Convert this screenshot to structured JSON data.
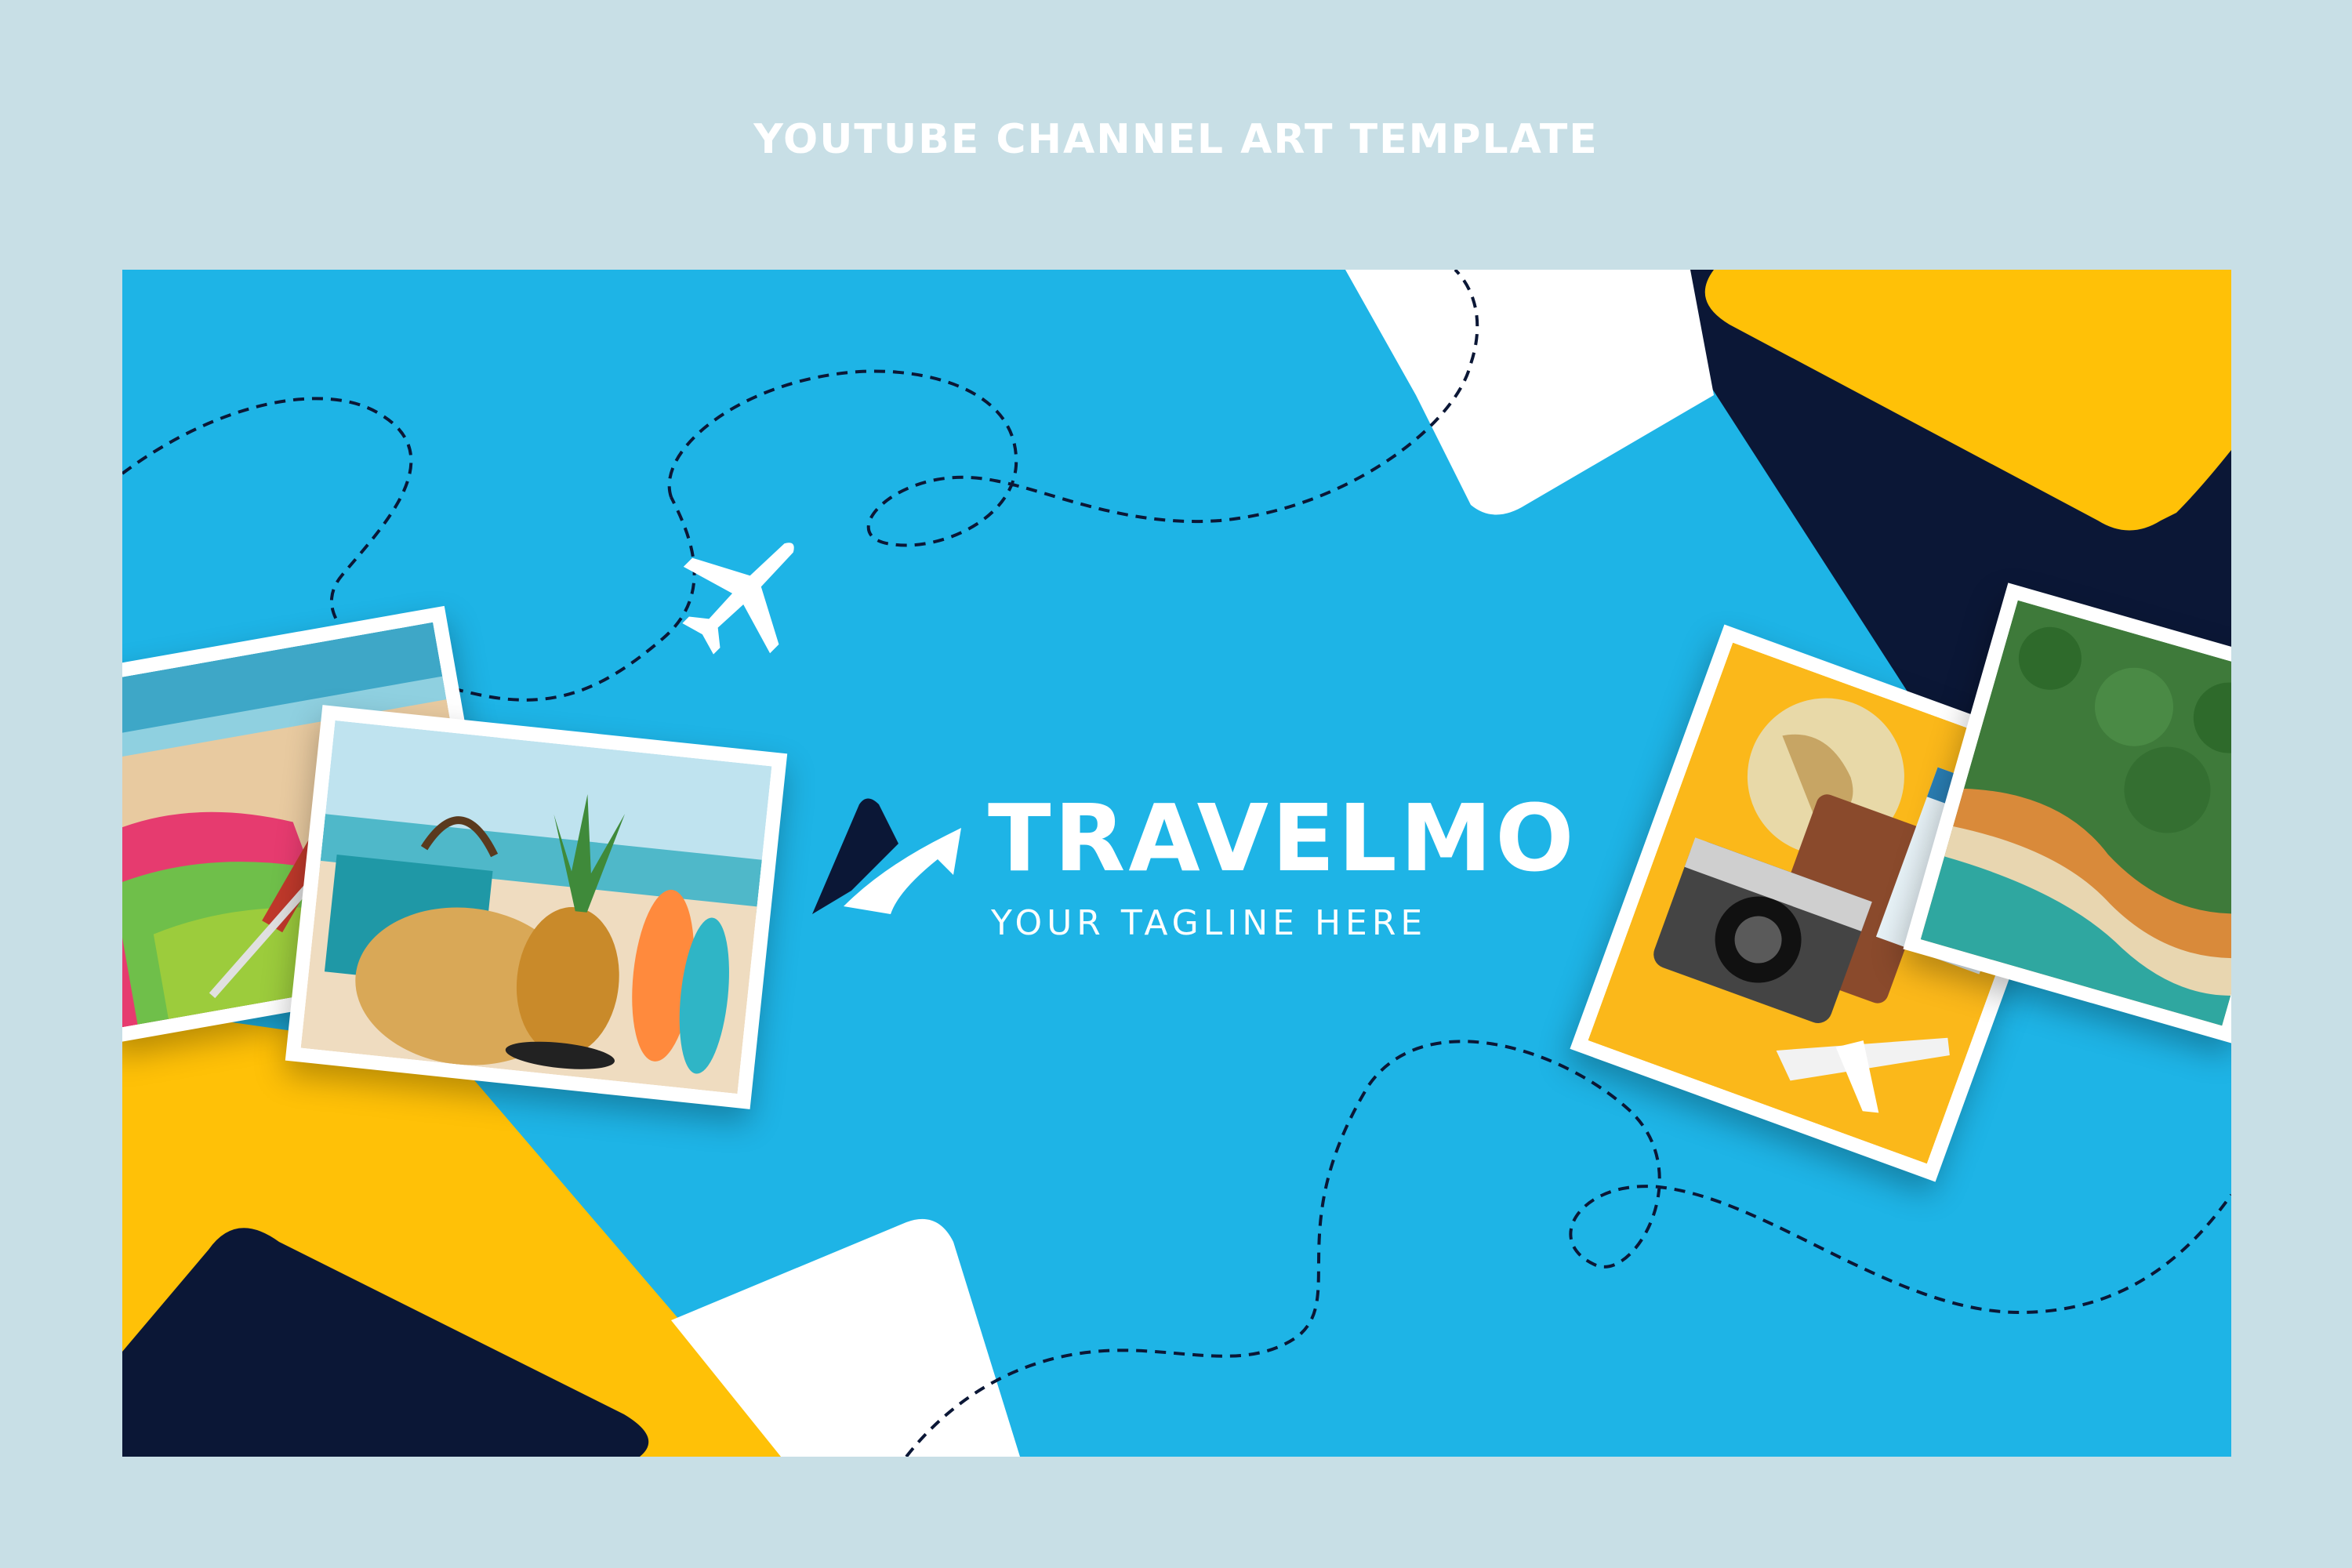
{
  "page": {
    "heading": "YOUTUBE CHANNEL ART TEMPLATE"
  },
  "banner": {
    "brand_name": "TRAVELMO",
    "tagline": "YOUR TAGLINE HERE",
    "colors": {
      "background": "#1eb4e6",
      "navy": "#0b1736",
      "yellow": "#ffc107",
      "white": "#ffffff"
    },
    "icons": [
      "airplane-icon",
      "travelmo-logo-icon"
    ],
    "photos": [
      {
        "subject": "beach towels and kayak paddle on sand"
      },
      {
        "subject": "pineapple, straw bag and flip-flops on beach"
      },
      {
        "subject": "globe, camera, passport, tickets and toy airplane on yellow"
      },
      {
        "subject": "coastline cliffs and sea aerial"
      }
    ]
  }
}
